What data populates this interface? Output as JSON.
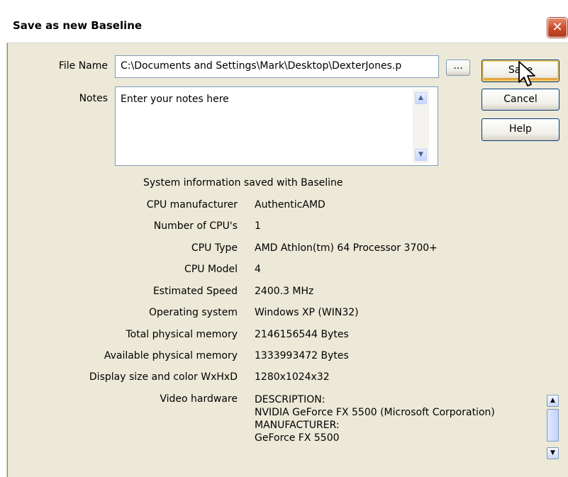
{
  "window": {
    "title": "Save as new Baseline",
    "close_glyph": "✕"
  },
  "form": {
    "file_name_label": "File Name",
    "file_name_value": "C:\\Documents and Settings\\Mark\\Desktop\\DexterJones.p",
    "browse_label": "...",
    "notes_label": "Notes",
    "notes_value": "Enter your notes here"
  },
  "buttons": {
    "save": "Save",
    "cancel": "Cancel",
    "help": "Help"
  },
  "sysinfo": {
    "heading": "System information saved with Baseline",
    "rows": [
      {
        "label": "CPU manufacturer",
        "value": "AuthenticAMD"
      },
      {
        "label": "Number of CPU's",
        "value": "1"
      },
      {
        "label": "CPU Type",
        "value": "AMD Athlon(tm) 64 Processor 3700+"
      },
      {
        "label": "CPU Model",
        "value": "4"
      },
      {
        "label": "Estimated Speed",
        "value": "2400.3 MHz"
      },
      {
        "label": "Operating system",
        "value": "Windows XP  (WIN32)"
      },
      {
        "label": "Total physical memory",
        "value": "2146156544 Bytes"
      },
      {
        "label": "Available physical memory",
        "value": "1333993472 Bytes"
      },
      {
        "label": "Display size and color WxHxD",
        "value": "1280x1024x32"
      }
    ],
    "video_label": "Video hardware",
    "video_lines": [
      "DESCRIPTION:",
      "NVIDIA GeForce FX 5500 (Microsoft Corporation)",
      "MANUFACTURER:",
      "GeForce FX 5500"
    ]
  },
  "icons": {
    "scroll_up": "▲",
    "scroll_down": "▼"
  },
  "colors": {
    "accent": "#003c74",
    "default_focus": "#f7c96a",
    "close": "#c74a2a",
    "dialog_bg": "#ece9d8"
  }
}
